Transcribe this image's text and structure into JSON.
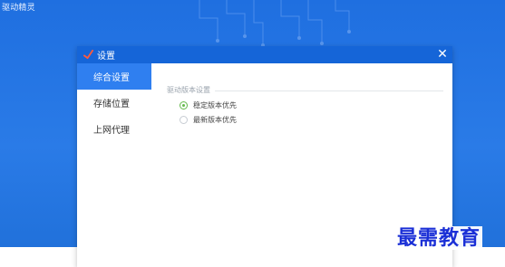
{
  "app": {
    "title": "驱动精灵"
  },
  "dialog": {
    "title": "设置",
    "close_icon": "close-icon",
    "sidebar": {
      "items": [
        {
          "label": "综合设置",
          "active": true
        },
        {
          "label": "存储位置",
          "active": false
        },
        {
          "label": "上网代理",
          "active": false
        }
      ]
    },
    "content": {
      "section_title": "驱动版本设置",
      "options": [
        {
          "label": "稳定版本优先",
          "checked": true
        },
        {
          "label": "最新版本优先",
          "checked": false
        }
      ]
    }
  },
  "watermark": {
    "text": "最需教育"
  },
  "colors": {
    "background_blue": "#1f6fe0",
    "header_blue": "#1565d8",
    "active_item_blue": "#2f7ff0",
    "radio_green": "#64b94b",
    "watermark_blue": "#1a2fd6"
  }
}
